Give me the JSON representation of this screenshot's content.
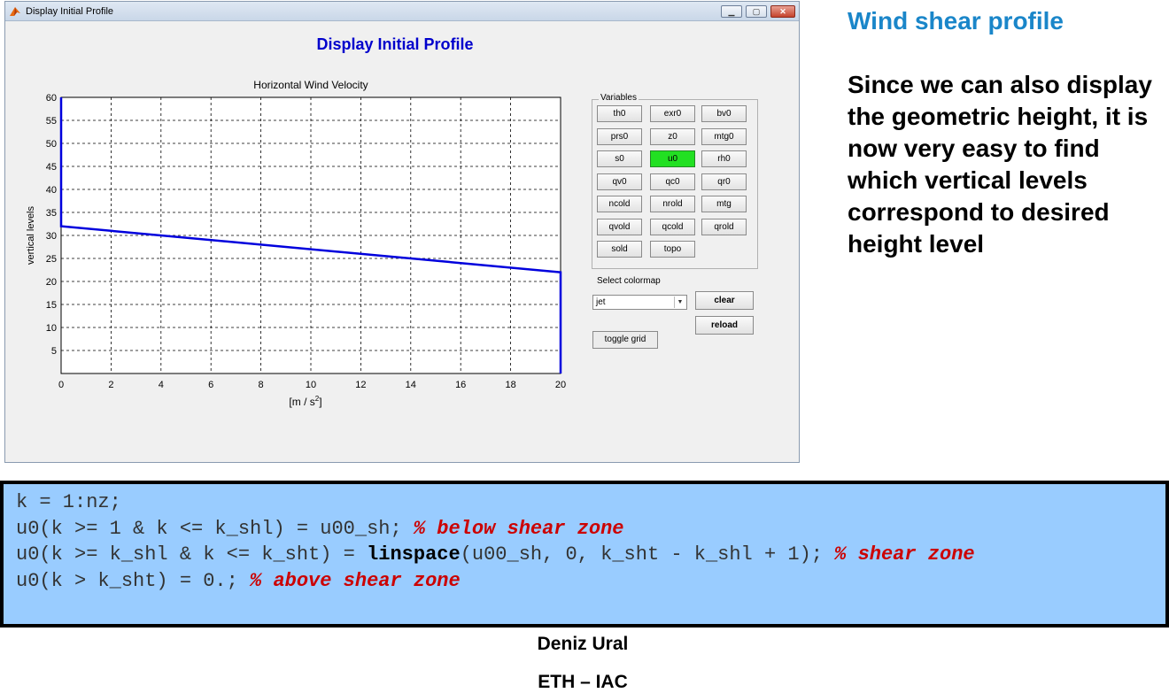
{
  "window": {
    "title": "Display Initial Profile",
    "figure_title": "Display Initial Profile"
  },
  "chart_data": {
    "type": "line",
    "title": "Horizontal Wind Velocity",
    "xlabel": "[m / s",
    "xlabel_sup": "2",
    "xlabel_end": "]",
    "ylabel": "vertical levels",
    "xlim": [
      0,
      20
    ],
    "ylim": [
      0,
      60
    ],
    "xticks": [
      0,
      2,
      4,
      6,
      8,
      10,
      12,
      14,
      16,
      18,
      20
    ],
    "yticks": [
      5,
      10,
      15,
      20,
      25,
      30,
      35,
      40,
      45,
      50,
      55,
      60
    ],
    "grid": true,
    "line_color": "#0000dd",
    "series": [
      {
        "x": [
          0,
          0,
          20,
          20
        ],
        "y": [
          60,
          32,
          22,
          0
        ]
      }
    ]
  },
  "variables": {
    "title": "Variables",
    "buttons": [
      [
        "th0",
        "exr0",
        "bv0"
      ],
      [
        "prs0",
        "z0",
        "mtg0"
      ],
      [
        "s0",
        "u0",
        "rh0"
      ],
      [
        "qv0",
        "qc0",
        "qr0"
      ],
      [
        "ncold",
        "nrold",
        "mtg"
      ],
      [
        "qvold",
        "qcold",
        "qrold"
      ],
      [
        "sold",
        "topo"
      ]
    ],
    "active": "u0"
  },
  "colormap": {
    "label": "Select colormap",
    "value": "jet"
  },
  "buttons": {
    "clear": "clear",
    "reload": "reload",
    "toggle_grid": "toggle grid"
  },
  "slide": {
    "title": "Wind shear profile",
    "text": "Since we can also display the geometric height, it is now very easy to find which vertical levels correspond to desired height level"
  },
  "code": {
    "line1": "k = 1:nz;",
    "line2_code": "u0(k >= 1 & k <= k_shl) = u00_sh; ",
    "line2_comment": "% below shear zone",
    "line3_pre": "u0(k >= k_shl & k <= k_sht) = ",
    "line3_kw": "linspace",
    "line3_post": "(u00_sh, 0, k_sht - k_shl + 1); ",
    "line3_comment": "% shear zone",
    "line4_code": "u0(k > k_sht) = 0.; ",
    "line4_comment": "% above shear zone"
  },
  "footer": {
    "author": "Deniz Ural",
    "affiliation": "ETH – IAC"
  }
}
